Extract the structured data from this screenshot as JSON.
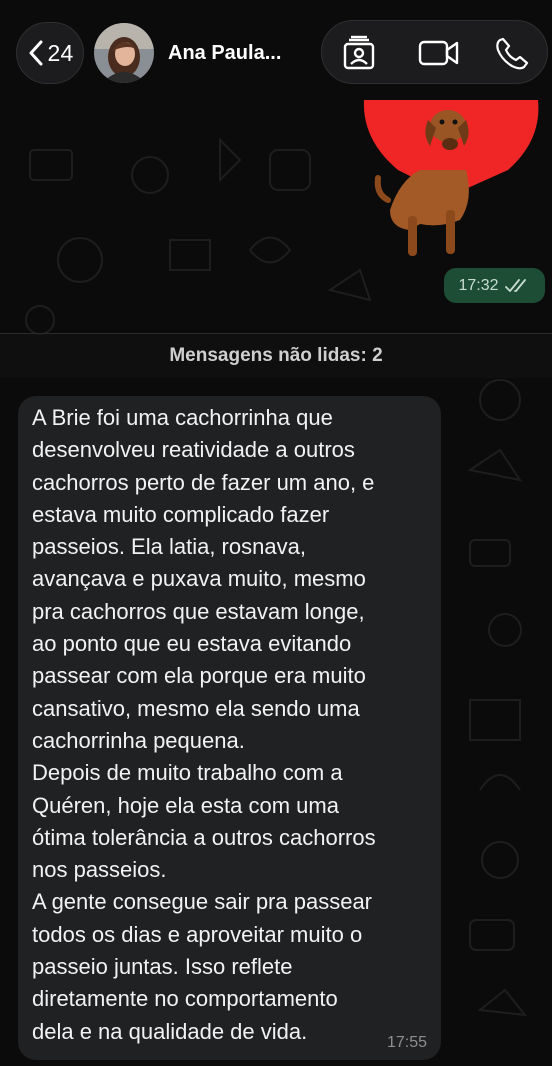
{
  "header": {
    "back_count": "24",
    "contact_name": "Ana Paula...",
    "icons": {
      "back": "chevron-left-icon",
      "contact_card": "contact-card-icon",
      "video": "video-camera-icon",
      "phone": "phone-icon"
    }
  },
  "outgoing": {
    "time": "17:32",
    "status_icon": "double-check-icon"
  },
  "unread_divider": "Mensagens não lidas: 2",
  "incoming": {
    "lines": [
      "A Brie foi uma cachorrinha que",
      "desenvolveu reatividade a outros",
      "cachorros perto de fazer um ano, e",
      "estava muito complicado fazer",
      "passeios. Ela latia, rosnava,",
      "avançava e puxava muito, mesmo",
      "pra cachorros que estavam longe,",
      "ao ponto que eu estava evitando",
      "passear com ela porque era muito",
      "cansativo, mesmo ela sendo uma",
      "cachorrinha pequena.",
      "Depois de muito trabalho com a",
      "Quéren, hoje ela esta com uma",
      "ótima tolerância a outros cachorros",
      "nos passeios.",
      "A gente consegue sair pra passear",
      "todos os dias e aproveitar muito o",
      "passeio juntas. Isso reflete",
      "diretamente no comportamento",
      "dela e na qualidade de vida."
    ],
    "time": "17:55"
  },
  "colors": {
    "background": "#0b0b0b",
    "bubble_incoming": "#1f2123",
    "time_pill_outgoing": "#1d4d35",
    "sticker_heart": "#f02626"
  }
}
